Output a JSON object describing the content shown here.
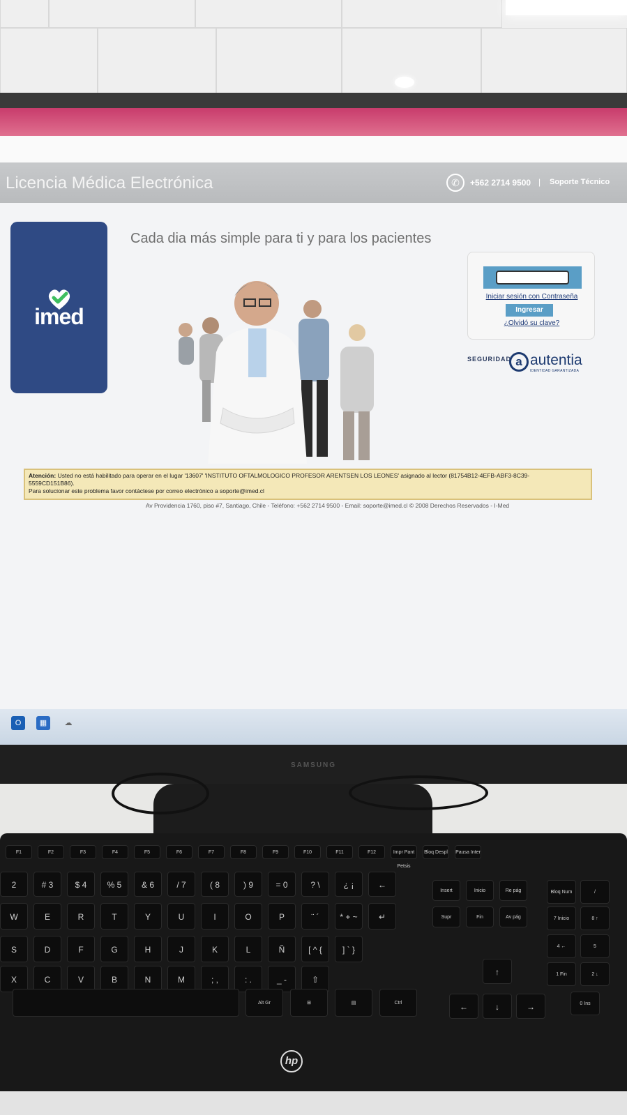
{
  "app": {
    "header_title": "Licencia Médica Electrónica",
    "phone": "+562 2714 9500",
    "separator": "|",
    "support": "Soporte Técnico"
  },
  "brand": {
    "logo_text": "imed",
    "tagline": "Cada dia más simple para ti y para los pacientes"
  },
  "login": {
    "password_field_value": "",
    "password_login_link": "Iniciar sesión con Contraseña",
    "submit_label": "Ingresar",
    "forgot_link": "¿Olvidó su clave?"
  },
  "security": {
    "label": "SEGURIDAD",
    "provider_mark": "a",
    "provider": "autentia",
    "provider_tagline": "IDENTIDAD GARANTIZADA"
  },
  "alert": {
    "prefix": "Atención:",
    "line1": " Usted no está habilitado para operar en el lugar '13607' 'INSTITUTO OFTALMOLOGICO PROFESOR ARENTSEN LOS LEONES' asignado al lector (81754B12-4EFB-ABF3-8C39-",
    "line2": "5559CD151B86).",
    "line3": "Para solucionar este problema favor contáctese por correo electrónico a soporte@imed.cl"
  },
  "footer": "Av Providencia 1760, piso #7, Santiago, Chile - Teléfono: +562 2714 9500 - Email: soporte@imed.cl © 2008 Derechos Reservados - I-Med",
  "monitor_brand": "SAMSUNG",
  "keyboard_brand": "hp",
  "keyboard": {
    "function_row": [
      "F1",
      "F2",
      "F3",
      "F4",
      "F5",
      "F6",
      "F7",
      "F8",
      "F9",
      "F10",
      "F11",
      "F12",
      "Impr Pant Petsis",
      "Bloq Despl",
      "Pausa Inter"
    ],
    "row_numbers": [
      "2",
      "# 3",
      "$ 4",
      "% 5",
      "& 6",
      "/ 7",
      "( 8",
      ") 9",
      "= 0",
      "? \\",
      "¿ ¡",
      "←"
    ],
    "row_qwerty": [
      "W",
      "E",
      "R",
      "T",
      "Y",
      "U",
      "I",
      "O",
      "P",
      "¨ ´",
      "* + ~",
      "↵"
    ],
    "row_home": [
      "S",
      "D",
      "F",
      "G",
      "H",
      "J",
      "K",
      "L",
      "Ñ",
      "[ ^ {",
      "] ` }"
    ],
    "row_bottom": [
      "X",
      "C",
      "V",
      "B",
      "N",
      "M",
      "; ,",
      ": .",
      "_ -",
      "⇧"
    ],
    "row_space": [
      "Alt Gr",
      "⊞",
      "▤",
      "Ctrl"
    ],
    "nav_keys": [
      "Insert",
      "Inicio",
      "Re pág",
      "Supr",
      "Fin",
      "Av pág",
      "↑",
      "←",
      "↓",
      "→"
    ],
    "numpad": [
      "Bloq Num",
      "/",
      "7 Inicio",
      "8 ↑",
      "4 ←",
      "5",
      "1 Fin",
      "2 ↓",
      "0 Ins"
    ]
  }
}
